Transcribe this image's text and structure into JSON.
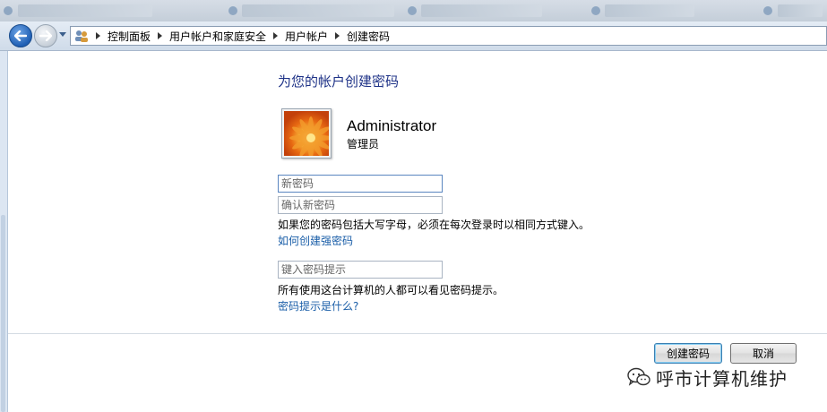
{
  "breadcrumb": {
    "items": [
      "控制面板",
      "用户帐户和家庭安全",
      "用户帐户",
      "创建密码"
    ]
  },
  "page": {
    "title": "为您的帐户创建密码"
  },
  "user": {
    "name": "Administrator",
    "role": "管理员"
  },
  "form": {
    "new_password_placeholder": "新密码",
    "confirm_password_placeholder": "确认新密码",
    "case_notice": "如果您的密码包括大写字母，必须在每次登录时以相同方式键入。",
    "strong_password_link": "如何创建强密码",
    "hint_placeholder": "键入密码提示",
    "hint_notice": "所有使用这台计算机的人都可以看见密码提示。",
    "hint_help_link": "密码提示是什么?"
  },
  "buttons": {
    "create": "创建密码",
    "cancel": "取消"
  },
  "watermark": {
    "text": "呼市计算机维护",
    "icon": "wechat-icon"
  },
  "colors": {
    "title": "#1e3287",
    "link": "#1a5ea8",
    "nav_back": "#1f5fb4"
  }
}
